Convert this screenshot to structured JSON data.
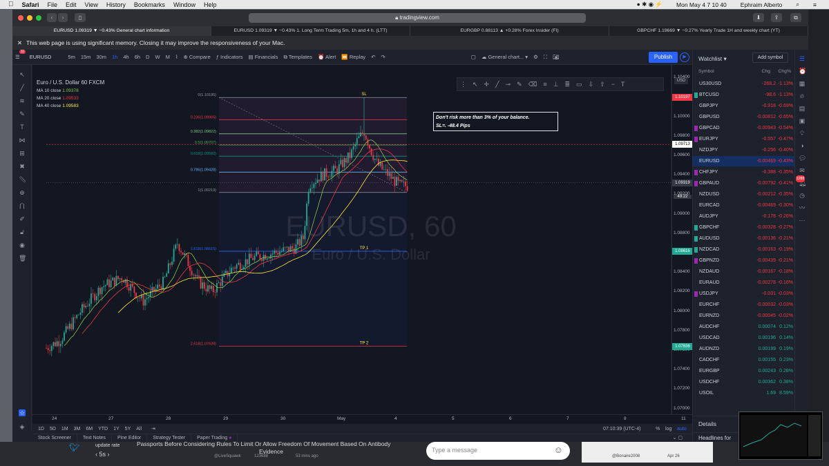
{
  "mac_menu": {
    "apple": "",
    "app": "Safari",
    "items": [
      "File",
      "Edit",
      "View",
      "History",
      "Bookmarks",
      "Window",
      "Help"
    ],
    "clock": "Mon May 4  7 10 40",
    "user": "Ephraim Alberto"
  },
  "safari": {
    "url": "tradingview.com",
    "tabs": [
      "EURUSD 1.09319 ▼ −0.43% General chart information",
      "EURUSD 1.09319 ▼ −0.43% 1. Long Term Trading 5m, 1h and 4 h. (LTT)",
      "EURGBP 0.88113 ▲ +0.28% Forex Insider (FI)",
      "GBPCHF 1.19669 ▼ −0.27% Yearly Trade 1H and weekly chart (YT)"
    ],
    "memory_warning": "This web page is using significant memory. Closing it may improve the responsiveness of your Mac."
  },
  "toolbar": {
    "symbol": "EURUSD",
    "intervals": [
      "5m",
      "15m",
      "30m",
      "1h",
      "4h",
      "6h",
      "D",
      "W",
      "M"
    ],
    "compare": "Compare",
    "indicators": "Indicators",
    "financials": "Financials",
    "templates": "Templates",
    "alert": "Alert",
    "replay": "Replay",
    "layout": "General chart...",
    "publish": "Publish",
    "notif_badge": "11"
  },
  "legend": {
    "title": "Euro / U.S. Dollar  60  FXCM",
    "ma10": "MA 10 close",
    "ma10v": "1.09378",
    "ma20": "MA 20 close",
    "ma20v": "1.09533",
    "ma40": "MA 40 close",
    "ma40v": "1.09583"
  },
  "watermark": {
    "main": "EURUSD, 60",
    "sub": "Euro / U.S. Dollar"
  },
  "note": {
    "line1": "Don't risk more than 3% of your balance.",
    "line2": "SL=.  -48.4 Pips"
  },
  "fib": [
    {
      "label": "0(1.10195)",
      "price": 1.10195,
      "color": "#9598a1"
    },
    {
      "label": "0.236(1.09965)",
      "price": 1.09965,
      "color": "#f23645"
    },
    {
      "label": "0.382(1.09822)",
      "price": 1.09822,
      "color": "#81c784"
    },
    {
      "label": "0.5(1.09707)",
      "price": 1.09707,
      "color": "#4caf50"
    },
    {
      "label": "0.618(1.09592)",
      "price": 1.09592,
      "color": "#089981"
    },
    {
      "label": "0.786(1.09428)",
      "price": 1.09428,
      "color": "#64b5f6"
    },
    {
      "label": "1(1.09219)",
      "price": 1.09219,
      "color": "#9598a1"
    },
    {
      "label": "1.618(1.08615)",
      "price": 1.08615,
      "color": "#2962ff"
    },
    {
      "label": "2.618(1.07639)",
      "price": 1.07639,
      "color": "#f23645"
    }
  ],
  "levels": {
    "sl": "SL",
    "tp1": "TP 1",
    "tp2": "TP 2",
    "countdown": "49:22"
  },
  "price_axis": {
    "label": "USD",
    "ticks": [
      "1.10400",
      "1.10000",
      "1.09800",
      "1.09600",
      "1.09400",
      "1.09200",
      "1.09000",
      "1.08800",
      "1.08600",
      "1.08400",
      "1.08200",
      "1.08000",
      "1.07800",
      "1.07600",
      "1.07400",
      "1.07200",
      "1.07000"
    ],
    "tags": [
      {
        "text": "1.10197",
        "price": 1.10197,
        "color": "#f23645"
      },
      {
        "text": "1.09713",
        "price": 1.09713,
        "color": "#ffffff"
      },
      {
        "text": "1.09319",
        "price": 1.09319,
        "color": "#363a45"
      },
      {
        "text": "1.08616",
        "price": 1.08616,
        "color": "#22ab94"
      },
      {
        "text": "1.07636",
        "price": 1.07636,
        "color": "#22ab94"
      }
    ]
  },
  "time_axis": [
    "24",
    "27",
    "28",
    "29",
    "30",
    "May",
    "4",
    "5",
    "6",
    "7",
    "8",
    "11"
  ],
  "ranges": [
    "1D",
    "5D",
    "1M",
    "3M",
    "6M",
    "YTD",
    "1Y",
    "5Y",
    "All"
  ],
  "clock_tz": "07:10:39 (UTC-4)",
  "axis_opts": [
    "%",
    "log",
    "auto"
  ],
  "bottom_tabs": [
    "Stock Screener",
    "Text Notes",
    "Pine Editor",
    "Strategy Tester",
    "Paper Trading"
  ],
  "watchlist": {
    "title": "Watchlist",
    "add": "Add symbol",
    "cols": [
      "Symbol",
      "Chg",
      "Chg%"
    ],
    "rows": [
      {
        "s": "US30USD",
        "c": "-268.2",
        "p": "-1.13%",
        "f": ""
      },
      {
        "s": "BTCUSD",
        "c": "-98.6",
        "p": "-1.13%",
        "f": "#22ab94"
      },
      {
        "s": "GBPJPY",
        "c": "-0.918",
        "p": "-0.69%",
        "f": ""
      },
      {
        "s": "GBPUSD",
        "c": "-0.00812",
        "p": "-0.65%",
        "f": ""
      },
      {
        "s": "GBPCAD",
        "c": "-0.00943",
        "p": "-0.54%",
        "f": "#9c27b0"
      },
      {
        "s": "EURJPY",
        "c": "-0.557",
        "p": "-0.47%",
        "f": "#9c27b0"
      },
      {
        "s": "NZDJPY",
        "c": "-0.256",
        "p": "-0.40%",
        "f": ""
      },
      {
        "s": "EURUSD",
        "c": "-0.00469",
        "p": "-0.43%",
        "f": ""
      },
      {
        "s": "CHFJPY",
        "c": "-0.388",
        "p": "-0.35%",
        "f": "#9c27b0"
      },
      {
        "s": "GBPAUD",
        "c": "-0.00792",
        "p": "-0.41%",
        "f": "#9c27b0"
      },
      {
        "s": "NZDUSD",
        "c": "-0.00212",
        "p": "-0.35%",
        "f": ""
      },
      {
        "s": "EURCAD",
        "c": "-0.00469",
        "p": "-0.30%",
        "f": ""
      },
      {
        "s": "AUDJPY",
        "c": "-0.178",
        "p": "-0.26%",
        "f": ""
      },
      {
        "s": "GBPCHF",
        "c": "-0.00328",
        "p": "-0.27%",
        "f": "#22ab94"
      },
      {
        "s": "AUDUSD",
        "c": "-0.00136",
        "p": "-0.21%",
        "f": "#22ab94"
      },
      {
        "s": "NZDCAD",
        "c": "-0.00163",
        "p": "-0.19%",
        "f": "#22ab94"
      },
      {
        "s": "GBPNZD",
        "c": "-0.00439",
        "p": "-0.21%",
        "f": "#9c27b0"
      },
      {
        "s": "NZDAUD",
        "c": "-0.00167",
        "p": "-0.18%",
        "f": ""
      },
      {
        "s": "EURAUD",
        "c": "-0.00278",
        "p": "-0.16%",
        "f": ""
      },
      {
        "s": "USDJPY",
        "c": "-0.031",
        "p": "-0.03%",
        "f": "#9c27b0"
      },
      {
        "s": "EURCHF",
        "c": "-0.00032",
        "p": "-0.03%",
        "f": ""
      },
      {
        "s": "EURNZD",
        "c": "-0.00045",
        "p": "-0.02%",
        "f": ""
      },
      {
        "s": "AUDCHF",
        "c": "0.00074",
        "p": "0.12%",
        "f": ""
      },
      {
        "s": "USDCAD",
        "c": "0.00196",
        "p": "0.14%",
        "f": ""
      },
      {
        "s": "AUDNZD",
        "c": "0.00199",
        "p": "0.19%",
        "f": ""
      },
      {
        "s": "CADCHF",
        "c": "0.00155",
        "p": "0.23%",
        "f": ""
      },
      {
        "s": "EURGBP",
        "c": "0.00243",
        "p": "0.28%",
        "f": ""
      },
      {
        "s": "USDCHF",
        "c": "0.00362",
        "p": "0.38%",
        "f": ""
      },
      {
        "s": "USOIL",
        "c": "1.69",
        "p": "8.59%",
        "f": ""
      }
    ],
    "details": "Details",
    "headlines": "Headlines for",
    "side_badge": "1288"
  },
  "background": {
    "update_rate": "update rate",
    "rate_val": "5s",
    "headline1": "Passports Before Considering Rules To Limit Or Allow Freedom Of Movement Based On Antibody",
    "headline2": "Evidence",
    "handle": "@LiveSquawk",
    "count": "123688",
    "ago": "53 mins ago",
    "message_placeholder": "Type a message",
    "handle2": "@Bonaire2008",
    "date2": "Apr 26"
  }
}
